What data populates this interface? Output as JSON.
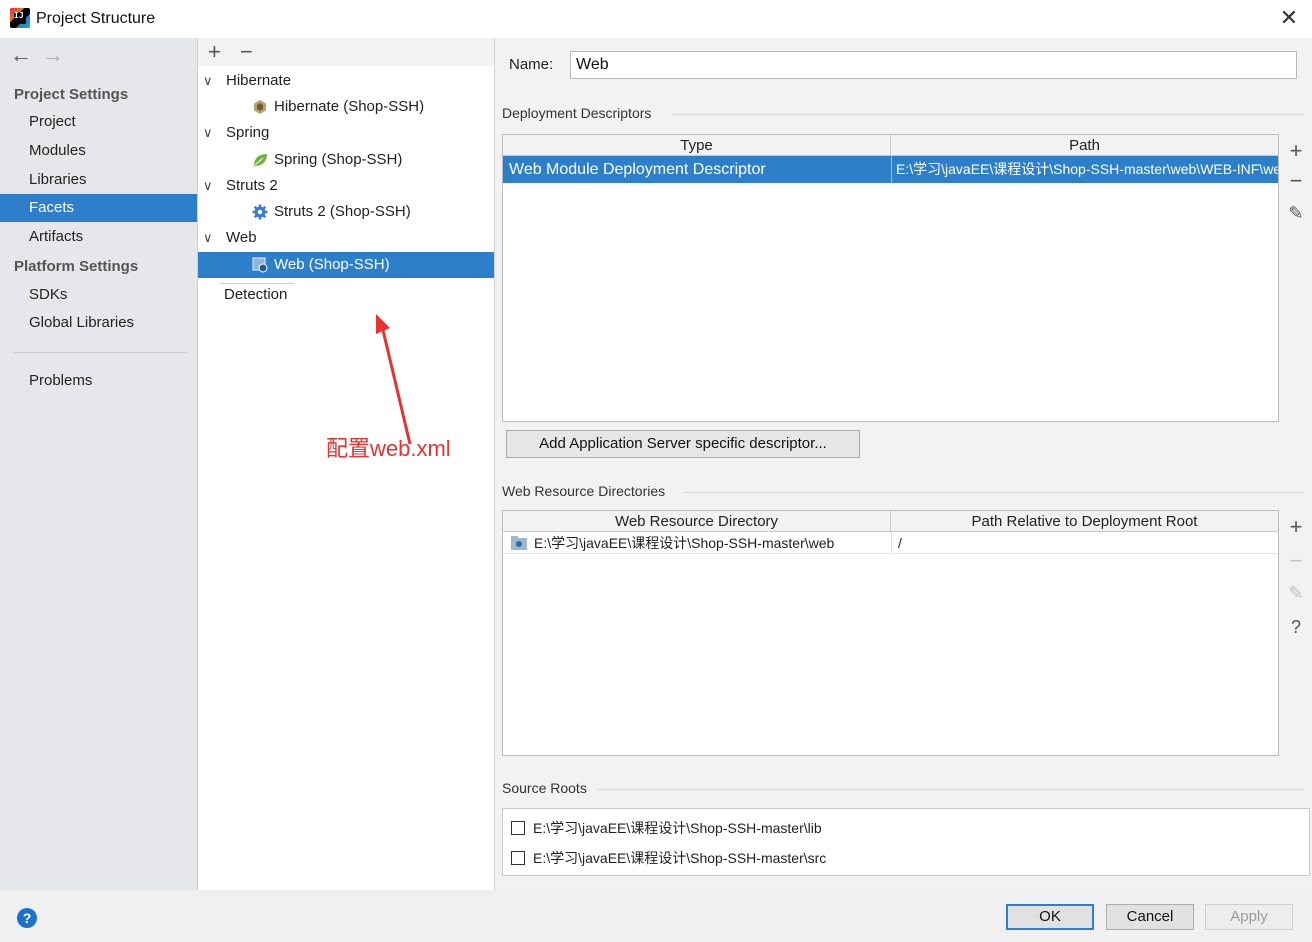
{
  "window": {
    "title": "Project Structure",
    "logo_text": "IJ",
    "close_glyph": "✕"
  },
  "nav": {
    "back": "←",
    "forward": "→"
  },
  "sidebar": {
    "sections": [
      {
        "title": "Project Settings",
        "items": [
          "Project",
          "Modules",
          "Libraries",
          "Facets",
          "Artifacts"
        ]
      },
      {
        "title": "Platform Settings",
        "items": [
          "SDKs",
          "Global Libraries"
        ]
      }
    ],
    "extra": [
      "Problems"
    ],
    "selected": "Facets"
  },
  "facets_toolbar": {
    "add": "+",
    "remove": "−"
  },
  "facets_tree": [
    {
      "label": "Hibernate",
      "child": "Hibernate (Shop-SSH)",
      "icon": "hibernate-icon"
    },
    {
      "label": "Spring",
      "child": "Spring (Shop-SSH)",
      "icon": "spring-leaf-icon"
    },
    {
      "label": "Struts 2",
      "child": "Struts 2 (Shop-SSH)",
      "icon": "struts-gear-icon"
    },
    {
      "label": "Web",
      "child": "Web (Shop-SSH)",
      "icon": "web-module-icon"
    }
  ],
  "facets_selected": "Web (Shop-SSH)",
  "detection": "Detection",
  "annotation": {
    "text": "配置web.xml",
    "color": "#e8322f"
  },
  "name_field": {
    "label": "Name:",
    "value": "Web"
  },
  "deployment": {
    "title": "Deployment Descriptors",
    "columns": [
      "Type",
      "Path"
    ],
    "rows": [
      {
        "type": "Web Module Deployment Descriptor",
        "path": "E:\\学习\\javaEE\\课程设计\\Shop-SSH-master\\web\\WEB-INF\\web.xml"
      }
    ],
    "tools": [
      "+",
      "−",
      "✎"
    ],
    "add_button": "Add Application Server specific descriptor..."
  },
  "web_resources": {
    "title": "Web Resource Directories",
    "columns": [
      "Web Resource Directory",
      "Path Relative to Deployment Root"
    ],
    "rows": [
      {
        "dir": "E:\\学习\\javaEE\\课程设计\\Shop-SSH-master\\web",
        "rel": "/"
      }
    ],
    "tools": [
      "+",
      "−",
      "✎",
      "?"
    ]
  },
  "source_roots": {
    "title": "Source Roots",
    "items": [
      {
        "label": "E:\\学习\\javaEE\\课程设计\\Shop-SSH-master\\lib",
        "checked": false
      },
      {
        "label": "E:\\学习\\javaEE\\课程设计\\Shop-SSH-master\\src",
        "checked": false
      }
    ]
  },
  "buttons": {
    "help": "?",
    "ok": "OK",
    "cancel": "Cancel",
    "apply": "Apply"
  },
  "colors": {
    "selection": "#2d7fc9",
    "sidebar_bg": "#e6e7ea",
    "panel_bg": "#f2f2f2"
  }
}
